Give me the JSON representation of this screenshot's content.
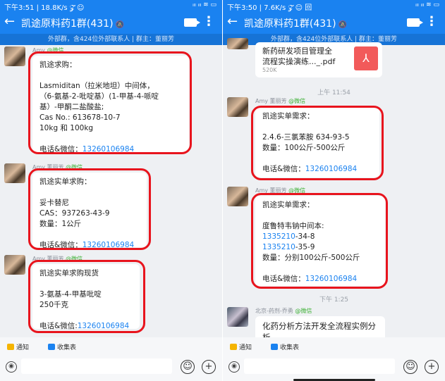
{
  "colors": {
    "accent": "#1a82f0",
    "highlight_ring": "#e8141d",
    "wechat_tag": "#3cb034"
  },
  "left": {
    "status_time": "下午3:51 | 18.8K/s 𝓩 ☺",
    "status_icons": "ᵢₗₗ ᵢₗₗ ≋ ▭",
    "title": "凯途原料药1群(431)",
    "mute_icon": "bell-muted-icon",
    "subtitle": "外部群，含424位外部联系人 | 群主：董丽芳",
    "messages": [
      {
        "sender": "Amy",
        "wechat_tag": "@微信",
        "lines": [
          "凯途求购：",
          "",
          "Lasmiditan（拉米地坦）中间体，",
          "（6-氨基-2-吡啶基）(1-甲基-4-哌啶",
          "基）-甲酮二盐酸盐;",
          "Cas No.: 613678-10-7",
          "10kg 和 100kg",
          ""
        ],
        "contact_label": "电话&微信：",
        "phone": "13260106984"
      },
      {
        "sender": "Amy 董丽芳",
        "wechat_tag": "@微信",
        "lines": [
          "凯途实单求购：",
          "",
          "妥卡替尼",
          "CAS：937263-43-9",
          "数量：1公斤",
          ""
        ],
        "contact_label": "电话&微信：",
        "phone": "13260106984"
      },
      {
        "sender": "Amy 董丽芳",
        "wechat_tag": "@微信",
        "lines": [
          "凯途实单求购现货",
          "",
          "3-氨基-4-甲基吡啶",
          "250千克",
          ""
        ],
        "contact_label": "电话&微信:",
        "phone": "13260106984"
      }
    ],
    "chips": [
      "通知",
      "收集表"
    ]
  },
  "right": {
    "status_time": "下午3:50 | 7.6K/s 𝓩 ☺ 回",
    "status_icons": "ᵢₗₗ ᵢₗₗ ≋ ▭",
    "title": "凯途原料药1群(431)",
    "mute_icon": "bell-muted-icon",
    "subtitle": "外部群，含424位外部联系人 | 群主：董丽芳",
    "file": {
      "name_line1": "新药研发项目管理全",
      "name_line2": "流程实操演练..._.pdf",
      "size": "520K"
    },
    "time1": "上午 11:54",
    "messages": [
      {
        "sender": "Amy 董丽芳",
        "wechat_tag": "@微信",
        "lines": [
          "凯途实单需求：",
          "",
          "2.4.6-三氯苯胺  634-93-5",
          "数量：100公斤-500公斤",
          ""
        ],
        "contact_label": "电话&微信：",
        "phone": "13260106984"
      },
      {
        "sender": "Amy 董丽芳",
        "wechat_tag": "@微信",
        "lines_before": [
          "凯途实单需求：",
          "",
          "度鲁特韦钠中间本:"
        ],
        "cas_lines": [
          {
            "phone_part": "1335210",
            "rest": "-34-8"
          },
          {
            "phone_part": "1335210",
            "rest": "-35-9"
          }
        ],
        "lines_after": [
          "数量：分别100公斤-500公斤",
          ""
        ],
        "contact_label": "电话&微信：",
        "phone": "13260106984"
      }
    ],
    "time2": "下午 1:25",
    "last": {
      "sender": "北京-药剂-乔勇",
      "wechat_tag": "@微信",
      "line1": "化药分析方法开发全流程实例分",
      "line2": "析"
    },
    "chips": [
      "通知",
      "收集表"
    ]
  }
}
